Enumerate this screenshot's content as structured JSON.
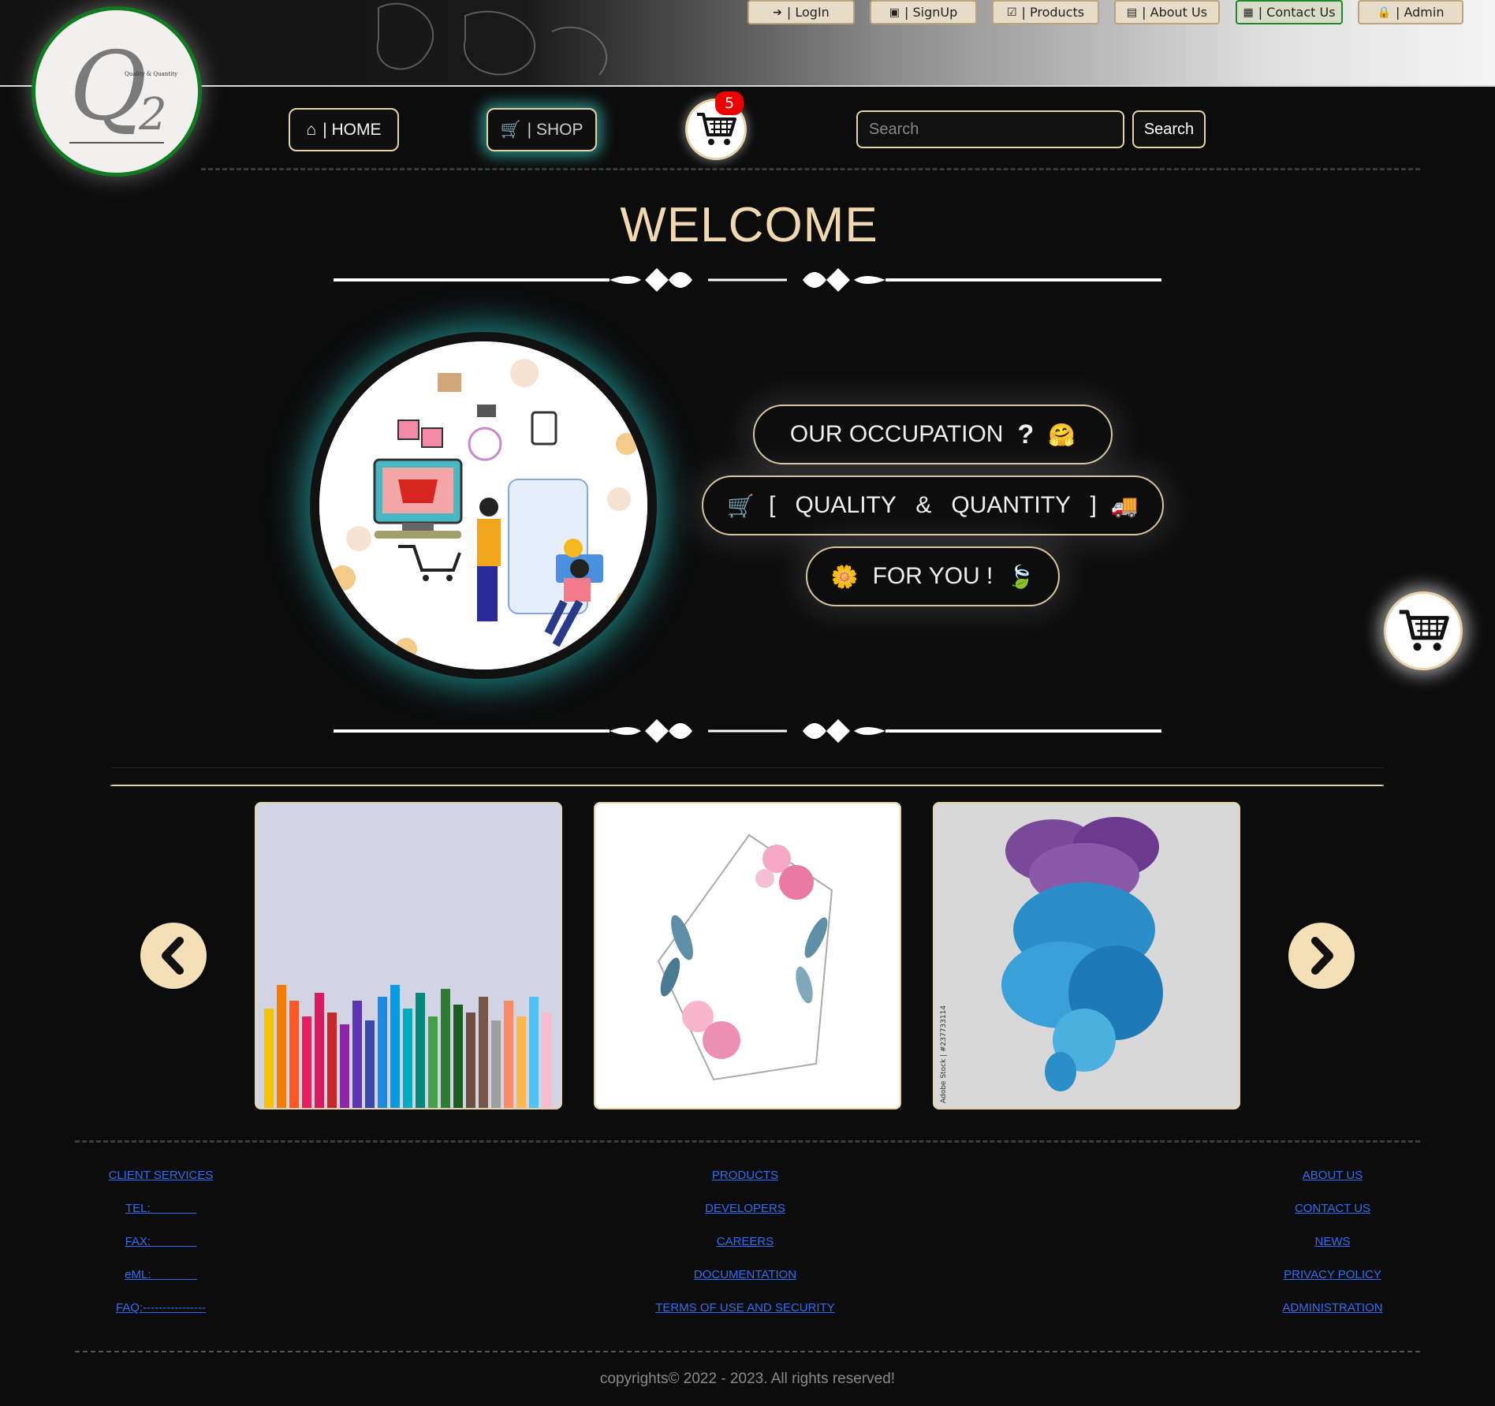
{
  "topnav": {
    "login": "| LogIn",
    "signup": "| SignUp",
    "products": "| Products",
    "about": "| About Us",
    "contact": "| Contact Us",
    "admin": "| Admin"
  },
  "logo": {
    "main": "Q",
    "sub": "2",
    "tagline": "Quality & Quantity"
  },
  "mainnav": {
    "home": "| HOME",
    "shop": "| SHOP",
    "cart_count": "5",
    "search_placeholder": "Search",
    "search_button": "Search"
  },
  "hero": {
    "welcome": "WELCOME",
    "pill1_text": "OUR OCCUPATION",
    "pill1_q": "?",
    "pill1_emoji": "🤗",
    "pill2_cart": "🛒",
    "pill2_text": "[   QUALITY   &   QUANTITY   ]",
    "pill2_truck": "🚚",
    "pill3_flower": "🌼",
    "pill3_text": "FOR YOU !",
    "pill3_leaf": "🍃"
  },
  "carousel": {
    "watermark": "Adobe Stock | #237733114"
  },
  "footer": {
    "col1": [
      "CLIENT SERVICES",
      "TEL:              ",
      "FAX:              ",
      "eML:              ",
      "FAQ:----------------"
    ],
    "col2": [
      "PRODUCTS",
      "DEVELOPERS",
      "CAREERS",
      "DOCUMENTATION",
      "TERMS OF USE AND SECURITY"
    ],
    "col3": [
      "ABOUT US",
      "CONTACT US",
      "NEWS",
      "PRIVACY POLICY",
      "ADMINISTRATION"
    ],
    "copyright": "copyrights© 2022 - 2023. All rights reserved!"
  },
  "colors": {
    "accent": "#e8d2a8",
    "welcome": "#f2d8ae",
    "glow": "#40dcd2",
    "link": "#2d6ff0",
    "badge": "#e00000"
  }
}
